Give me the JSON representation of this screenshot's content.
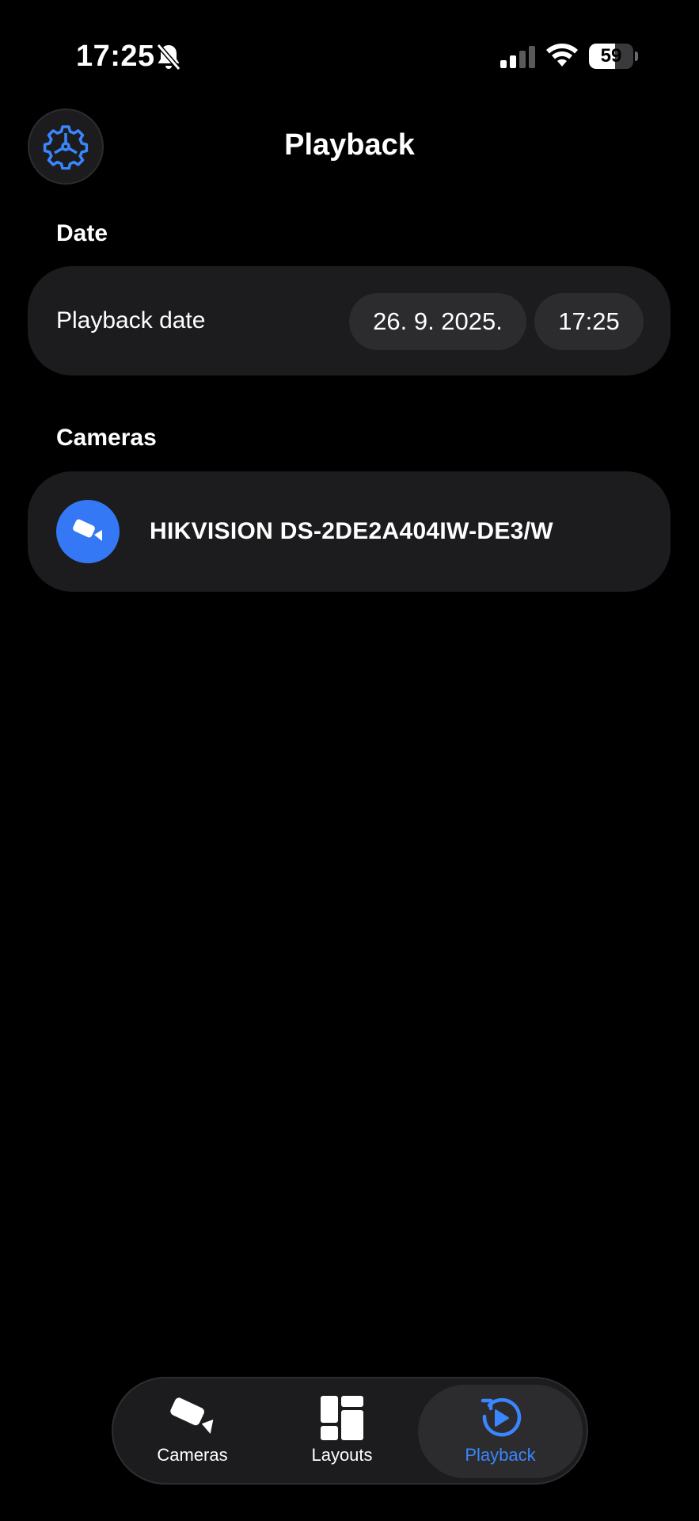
{
  "status_bar": {
    "time": "17:25",
    "battery": "59",
    "battery_level": 0.59,
    "icons": [
      "bell-off-icon",
      "signal-icon",
      "wifi-icon",
      "battery-icon"
    ]
  },
  "header": {
    "title": "Playback",
    "settings_icon": "gear-icon"
  },
  "date_section": {
    "header": "Date",
    "label": "Playback date",
    "date_value": "26. 9. 2025.",
    "time_value": "17:25"
  },
  "cameras_section": {
    "header": "Cameras",
    "items": [
      {
        "name": "HIKVISION DS-2DE2A404IW-DE3/W",
        "icon": "security-camera-icon"
      }
    ]
  },
  "tab_bar": {
    "tabs": [
      {
        "label": "Cameras",
        "icon": "security-camera-icon",
        "active": false
      },
      {
        "label": "Layouts",
        "icon": "layout-grid-icon",
        "active": false
      },
      {
        "label": "Playback",
        "icon": "playback-icon",
        "active": true
      }
    ]
  },
  "colors": {
    "background": "#000000",
    "card": "#1c1c1e",
    "pill": "#2c2c2e",
    "accent": "#3a86ff",
    "camera_avatar": "#3478f6"
  }
}
